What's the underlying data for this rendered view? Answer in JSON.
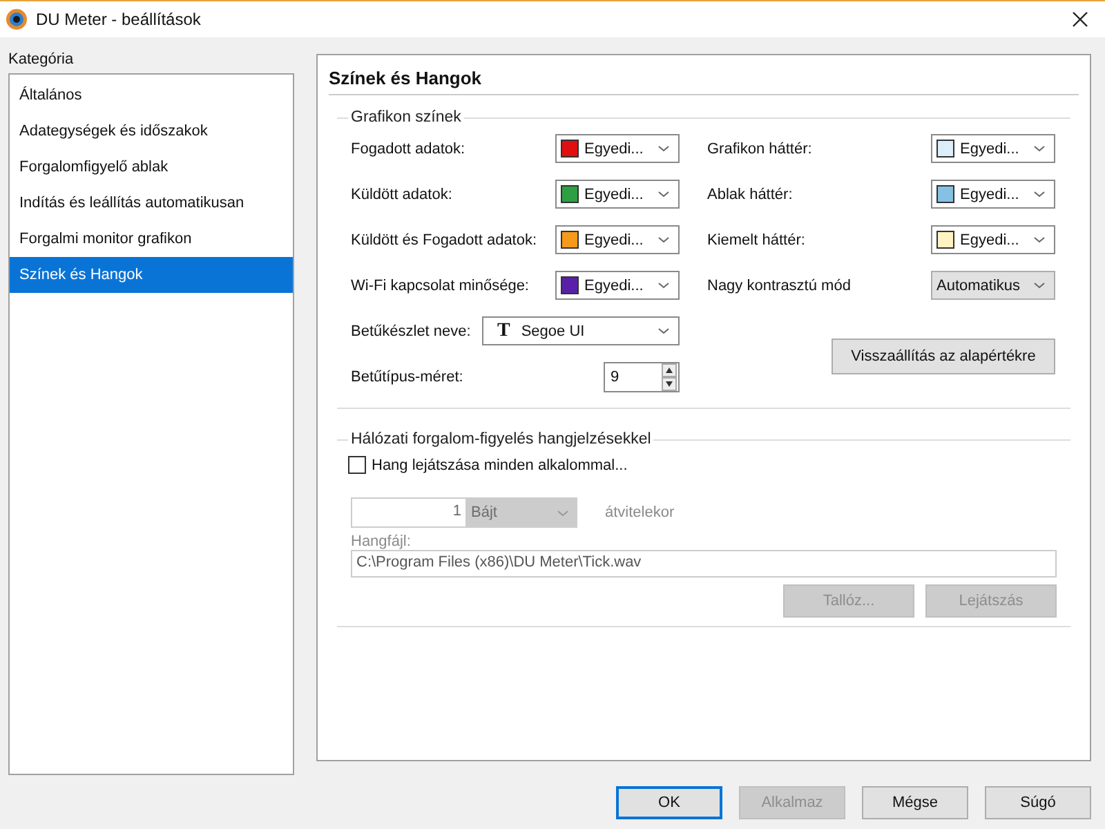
{
  "window": {
    "title": "DU Meter - beállítások"
  },
  "category": {
    "label": "Kategória",
    "items": [
      {
        "label": "Általános",
        "selected": false
      },
      {
        "label": "Adategységek és időszakok",
        "selected": false
      },
      {
        "label": "Forgalomfigyelő ablak",
        "selected": false
      },
      {
        "label": "Indítás és leállítás automatikusan",
        "selected": false
      },
      {
        "label": "Forgalmi monitor grafikon",
        "selected": false
      },
      {
        "label": "Színek és Hangok",
        "selected": true
      }
    ]
  },
  "panel": {
    "title": "Színek és Hangok",
    "graph_colors": {
      "title": "Grafikon színek",
      "left": [
        {
          "kind": "color",
          "label": "Fogadott adatok:",
          "color": "#e01010",
          "value": "Egyedi..."
        },
        {
          "kind": "color",
          "label": "Küldött adatok:",
          "color": "#2ea043",
          "value": "Egyedi..."
        },
        {
          "kind": "color",
          "label": "Küldött és Fogadott adatok:",
          "color": "#f59a1b",
          "value": "Egyedi..."
        },
        {
          "kind": "color",
          "label": "Wi-Fi kapcsolat minősége:",
          "color": "#5a1fa8",
          "value": "Egyedi..."
        },
        {
          "kind": "font",
          "label": "Betűkészlet neve:",
          "icon": "T",
          "value": "Segoe UI"
        },
        {
          "kind": "number",
          "label": "Betűtípus-méret:",
          "value": "9"
        }
      ],
      "right": [
        {
          "kind": "color",
          "label": "Grafikon háttér:",
          "color": "#dceefa",
          "value": "Egyedi..."
        },
        {
          "kind": "color",
          "label": "Ablak háttér:",
          "color": "#86c0e4",
          "value": "Egyedi..."
        },
        {
          "kind": "color",
          "label": "Kiemelt háttér:",
          "color": "#fff3c2",
          "value": "Egyedi..."
        },
        {
          "kind": "select",
          "label": "Nagy kontrasztú mód",
          "value": "Automatikus"
        }
      ],
      "reset_button": "Visszaállítás az alapértékre"
    },
    "sound": {
      "title": "Hálózati forgalom-figyelés hangjelzésekkel",
      "checkbox": {
        "label": "Hang lejátszása minden alkalommal...",
        "checked": false
      },
      "amount": {
        "value": "1",
        "unit": "Bájt",
        "suffix": "átvitelekor",
        "disabled": true
      },
      "file": {
        "label": "Hangfájl:",
        "value": "C:\\Program Files (x86)\\DU Meter\\Tick.wav",
        "disabled": true
      },
      "buttons": [
        {
          "label": "Tallóz...",
          "disabled": true
        },
        {
          "label": "Lejátszás",
          "disabled": true
        }
      ]
    }
  },
  "buttons": [
    {
      "label": "OK",
      "disabled": false,
      "default": true
    },
    {
      "label": "Alkalmaz",
      "disabled": true,
      "default": false
    },
    {
      "label": "Mégse",
      "disabled": false,
      "default": false
    },
    {
      "label": "Súgó",
      "disabled": false,
      "default": false
    }
  ]
}
